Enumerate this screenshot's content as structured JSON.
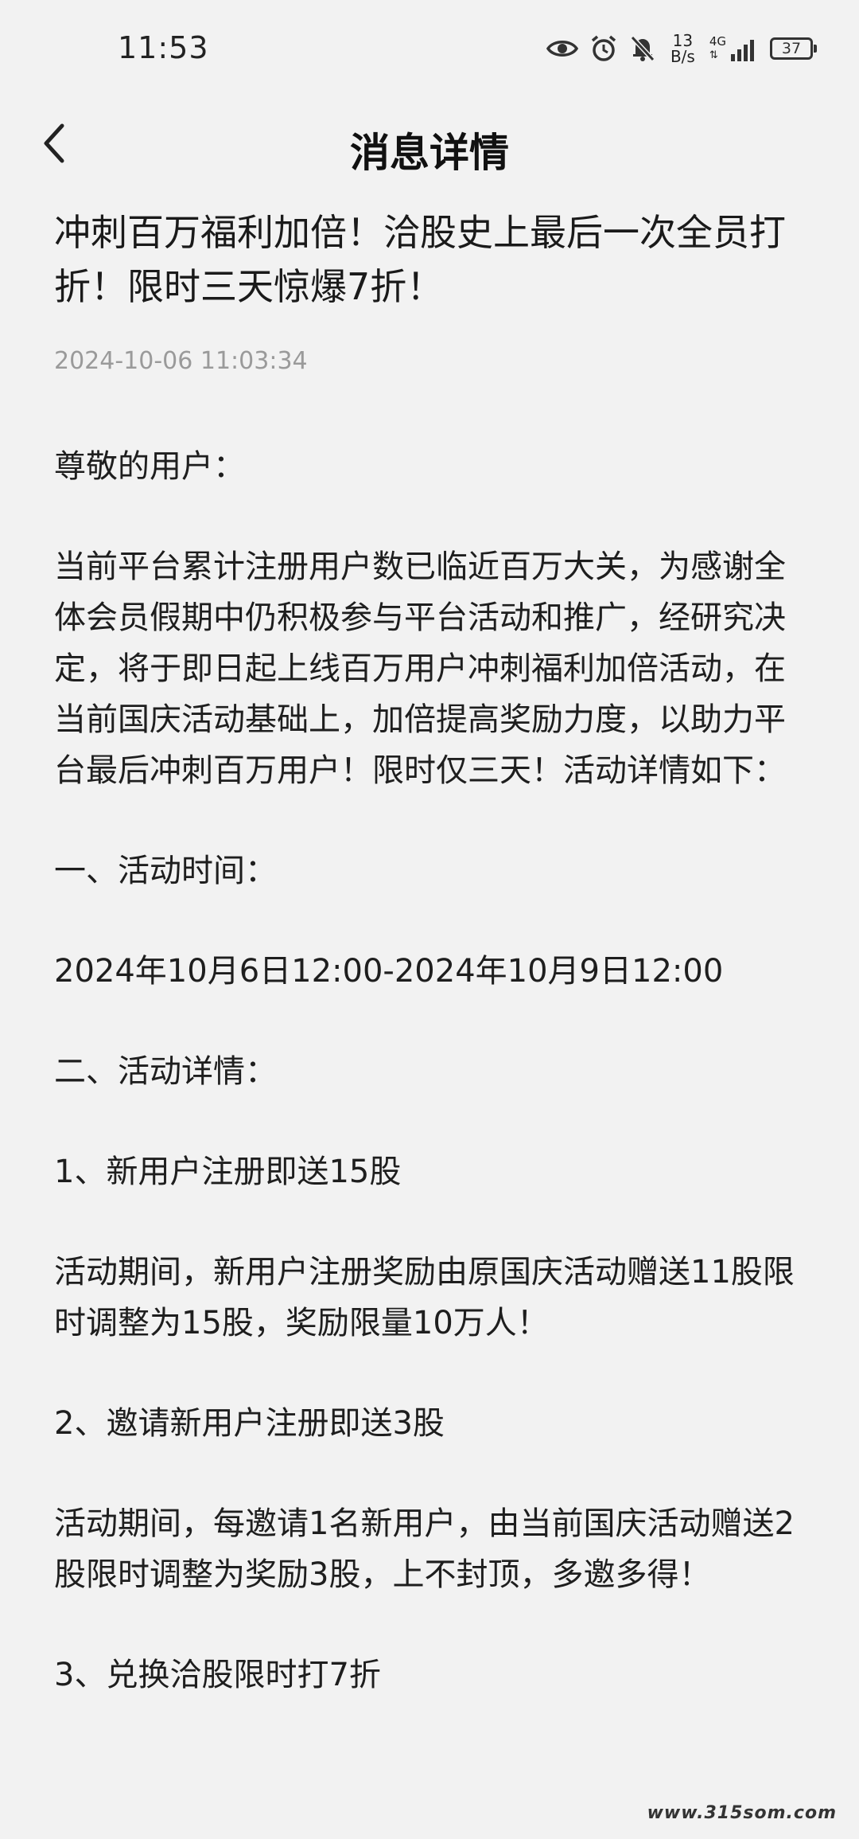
{
  "status_bar": {
    "time": "11:53",
    "net_speed_value": "13",
    "net_speed_unit": "B/s",
    "network_type": "4G",
    "battery": "37",
    "icons": [
      "eye-icon",
      "alarm-icon",
      "bell-muted-icon",
      "signal-icon",
      "battery-icon"
    ]
  },
  "nav": {
    "title": "消息详情"
  },
  "article": {
    "title": "冲刺百万福利加倍！洽股史上最后一次全员打折！限时三天惊爆7折！",
    "time": "2024-10-06 11:03:34",
    "paragraphs": [
      "尊敬的用户：",
      "当前平台累计注册用户数已临近百万大关，为感谢全体会员假期中仍积极参与平台活动和推广，经研究决定，将于即日起上线百万用户冲刺福利加倍活动，在当前国庆活动基础上，加倍提高奖励力度，以助力平台最后冲刺百万用户！限时仅三天！活动详情如下：",
      "一、活动时间：",
      "2024年10月6日12:00-2024年10月9日12:00",
      "二、活动详情：",
      "1、新用户注册即送15股",
      "活动期间，新用户注册奖励由原国庆活动赠送11股限时调整为15股，奖励限量10万人！",
      "2、邀请新用户注册即送3股",
      "活动期间，每邀请1名新用户，由当前国庆活动赠送2股限时调整为奖励3股，上不封顶，多邀多得！",
      "3、兑换洽股限时打7折"
    ]
  },
  "watermark": "www.315som.com"
}
